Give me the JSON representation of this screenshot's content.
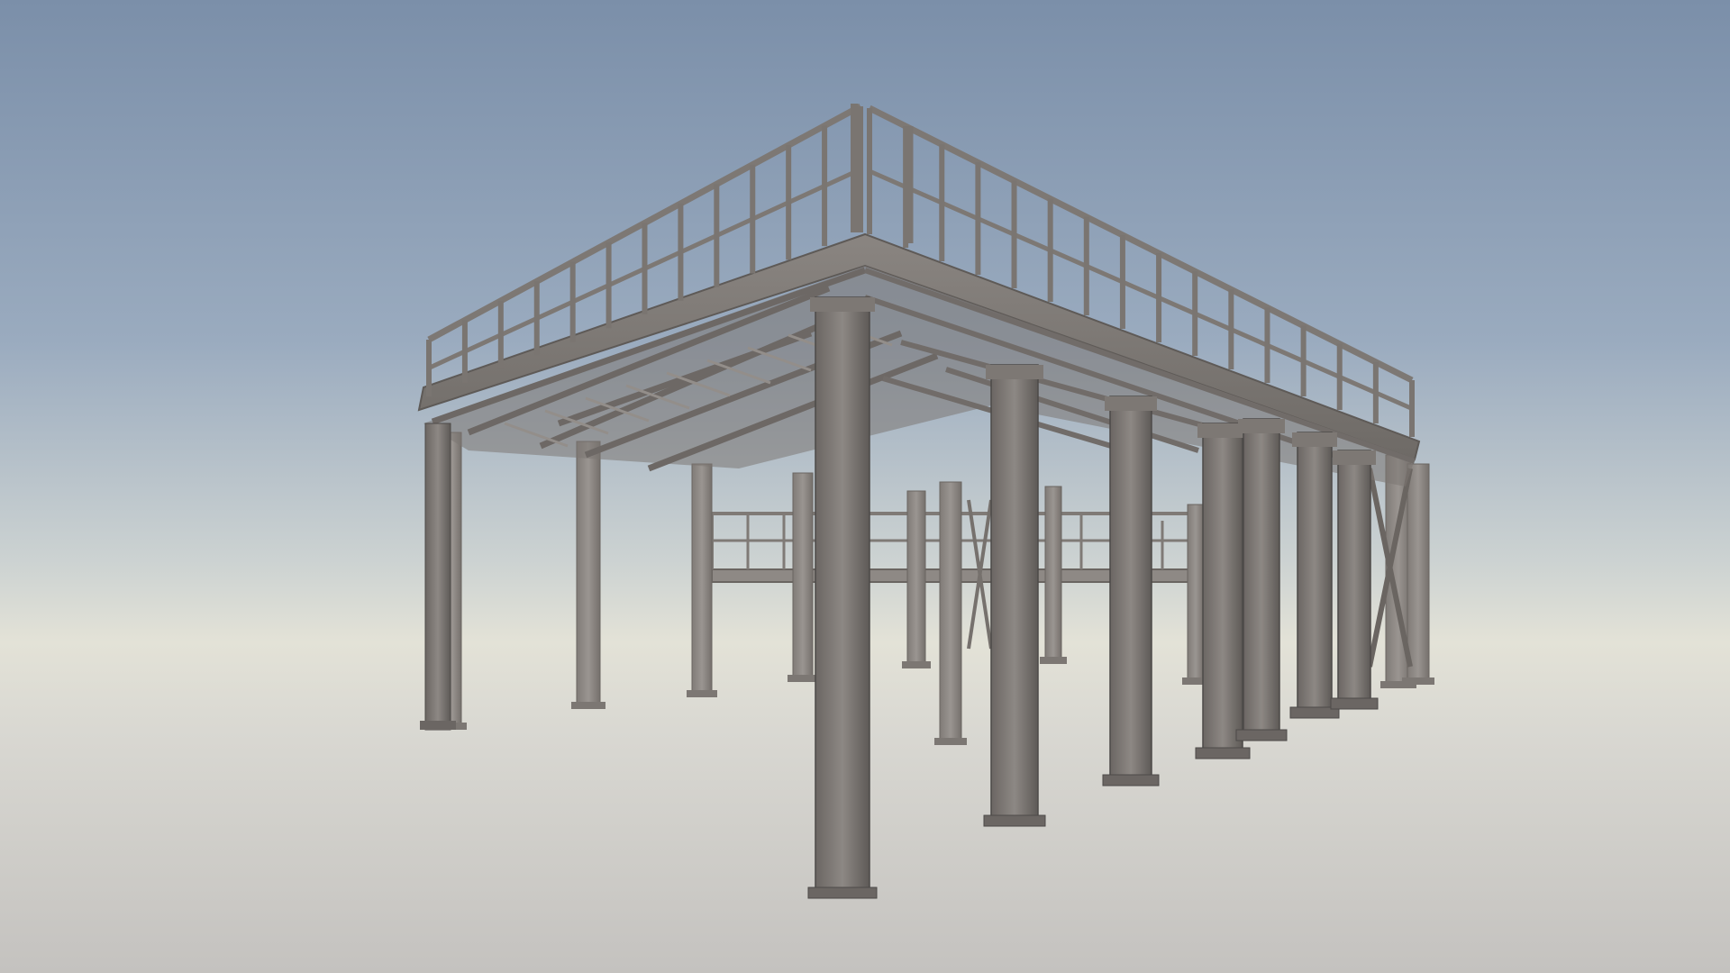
{
  "scene": {
    "subject": "steel-platform-structure",
    "colors": {
      "sky_top": "#7b8fa9",
      "sky_mid": "#a9b7c7",
      "horizon": "#e3e2d7",
      "ground_near": "#c5c3c0",
      "ground_far": "#d5d4cf",
      "steel_dark": "#5a5654",
      "steel_mid": "#77726e",
      "steel_light": "#9a9590",
      "steel_shadow": "#4a4745"
    }
  }
}
